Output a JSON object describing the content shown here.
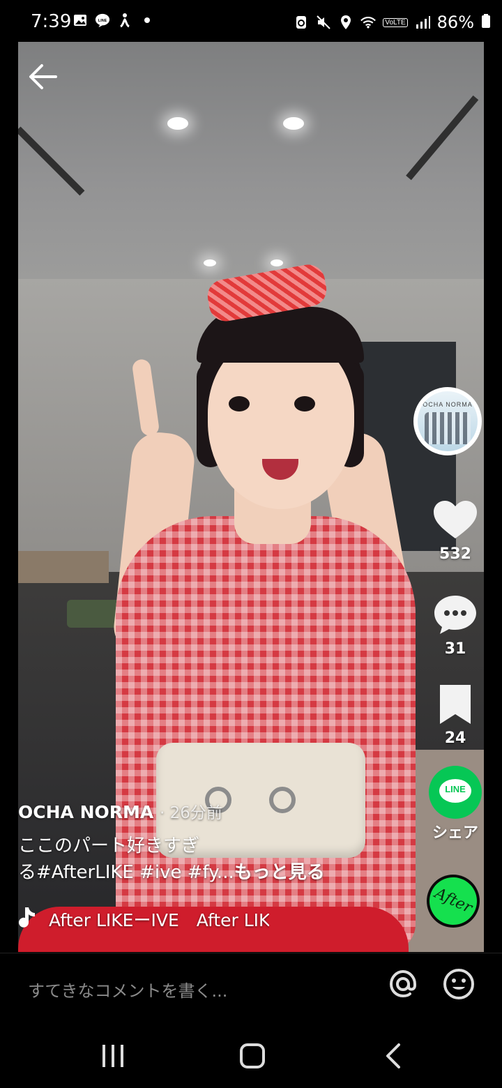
{
  "status_bar": {
    "time": "7:39",
    "left_icons": [
      "image-icon",
      "line-icon",
      "accessibility-icon",
      "dot-icon"
    ],
    "right_icons": [
      "recycle-icon",
      "mute-icon",
      "location-icon",
      "wifi-icon",
      "volte-icon",
      "signal-icon"
    ],
    "volte_label": "VoLTE",
    "battery": "86%"
  },
  "video": {
    "back_label": "back"
  },
  "rail": {
    "avatar_text": "OCHA NORMA",
    "likes": "532",
    "comments": "31",
    "bookmarks": "24",
    "line_label": "LINE",
    "share_label": "シェア",
    "disc_text": "After"
  },
  "caption": {
    "author": "OCHA NORMA",
    "ago": "· 26分前",
    "desc_line1": "ここのパート好きすぎ",
    "desc_line2": "る#AfterLIKE #ive #fy...",
    "more": "もっと見る"
  },
  "music": {
    "song": "After LIKEーIVE　After LIKE"
  },
  "comment_bar": {
    "placeholder": "すてきなコメントを書く..."
  },
  "colors": {
    "line_green": "#06c755",
    "disc_green": "#15e04e",
    "background": "#000000"
  }
}
